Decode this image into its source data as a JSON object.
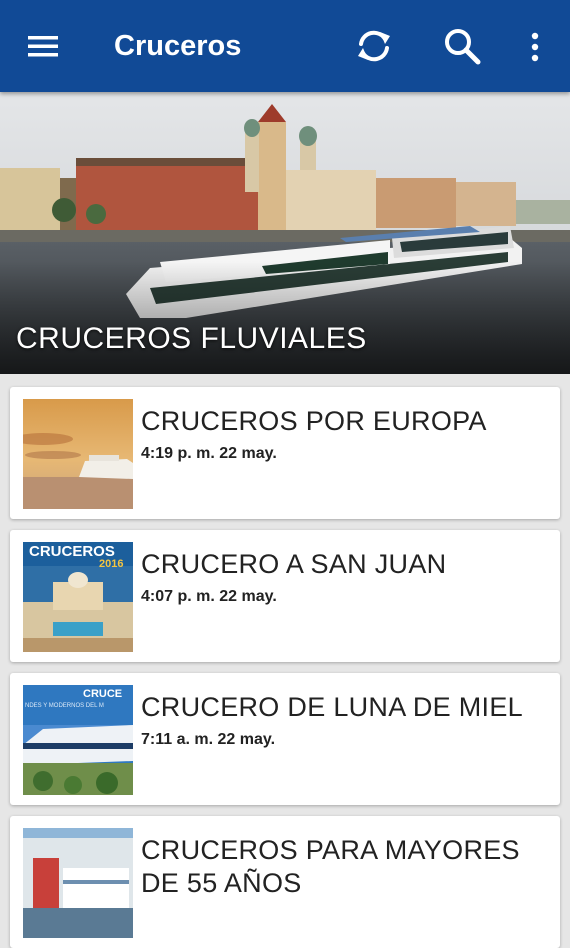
{
  "appbar": {
    "title": "Cruceros",
    "menu_icon": "menu-icon",
    "refresh_icon": "refresh-icon",
    "search_icon": "search-icon",
    "more_icon": "more-vert-icon",
    "background": "#114a96"
  },
  "hero": {
    "title": "CRUCEROS FLUVIALES"
  },
  "items": [
    {
      "title": "CRUCEROS POR EUROPA",
      "time": "4:19 p. m. 22 may."
    },
    {
      "title": "CRUCERO A SAN JUAN",
      "time": "4:07 p. m. 22 may.",
      "thumb_caption": "CRUCEROS",
      "thumb_year": "2016"
    },
    {
      "title": "CRUCERO DE LUNA DE MIEL",
      "time": "7:11 a. m. 22 may.",
      "thumb_caption": "CRUCE",
      "thumb_subcaption": "NDES Y MODERNOS DEL M"
    },
    {
      "title": "CRUCEROS PARA MAYORES DE 55 AÑOS"
    }
  ]
}
